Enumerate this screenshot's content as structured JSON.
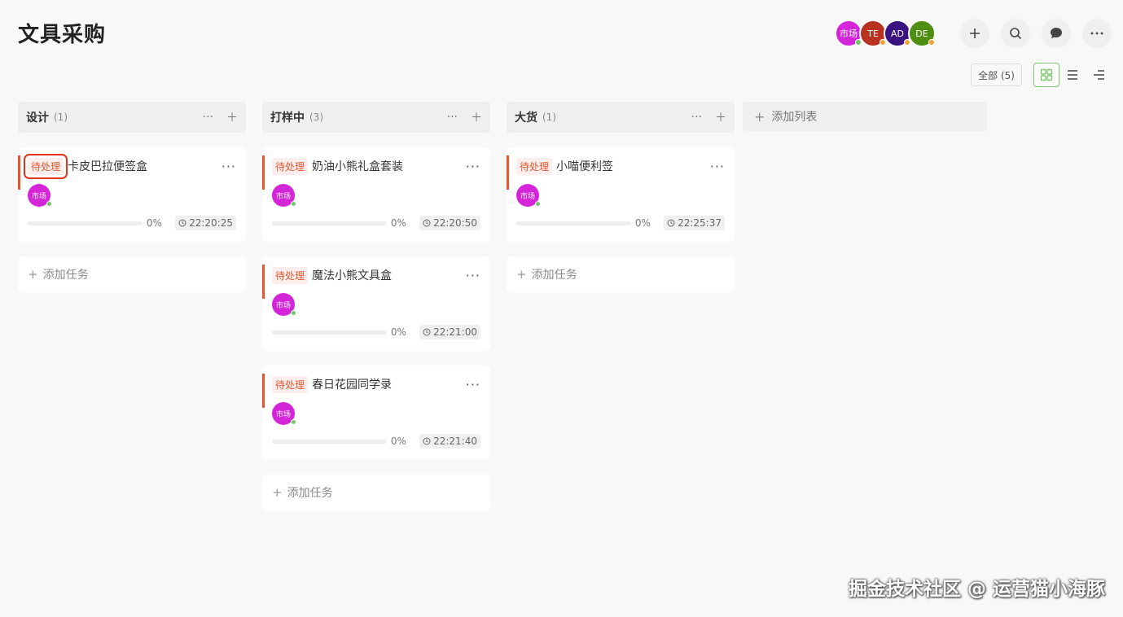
{
  "page_title": "文具采购",
  "header": {
    "avatars": [
      {
        "label": "市场",
        "bg": "#d426d8",
        "dot": "#74c66b"
      },
      {
        "label": "TE",
        "bg": "#b83220",
        "dot": "#f0a23a"
      },
      {
        "label": "AD",
        "bg": "#3b1380",
        "dot": "#f0a23a"
      },
      {
        "label": "DE",
        "bg": "#4e8f12",
        "dot": "#f0a23a"
      }
    ],
    "buttons": [
      "plus-icon",
      "search-icon",
      "chat-icon",
      "more-icon"
    ]
  },
  "toolbar": {
    "filter_label": "全部 (5)",
    "views": [
      "board-view-icon",
      "list-view-icon",
      "tree-view-icon"
    ],
    "active_view": "board-view-icon"
  },
  "columns": [
    {
      "title": "设计",
      "count": "(1)",
      "cards": [
        {
          "tag": "待处理",
          "name": "卡皮巴拉便签盒",
          "user": "市场",
          "progress": 0,
          "pct": "0%",
          "time": "22:20:25"
        }
      ],
      "add_task": "添加任务"
    },
    {
      "title": "打样中",
      "count": "(3)",
      "cards": [
        {
          "tag": "待处理",
          "name": "奶油小熊礼盒套装",
          "user": "市场",
          "progress": 0,
          "pct": "0%",
          "time": "22:20:50"
        },
        {
          "tag": "待处理",
          "name": "魔法小熊文具盒",
          "user": "市场",
          "progress": 0,
          "pct": "0%",
          "time": "22:21:00"
        },
        {
          "tag": "待处理",
          "name": "春日花园同学录",
          "user": "市场",
          "progress": 0,
          "pct": "0%",
          "time": "22:21:40"
        }
      ],
      "add_task": "添加任务"
    },
    {
      "title": "大货",
      "count": "(1)",
      "cards": [
        {
          "tag": "待处理",
          "name": "小喵便利签",
          "user": "市场",
          "progress": 0,
          "pct": "0%",
          "time": "22:25:37"
        }
      ],
      "add_task": "添加任务"
    }
  ],
  "add_list_label": "添加列表",
  "watermark": "掘金技术社区 @ 运营猫小海豚",
  "colors": {
    "accent": "#7cc46f",
    "tag": "#e4572e",
    "selection": "#e0331a"
  }
}
